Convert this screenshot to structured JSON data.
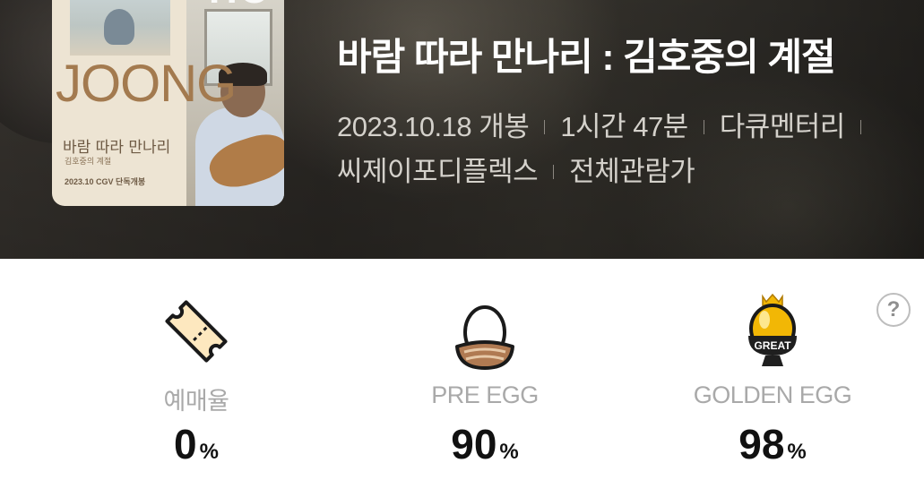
{
  "movie": {
    "title": "바람 따라 만나리 : 김호중의 계절",
    "release": "2023.10.18 개봉",
    "runtime": "1시간 47분",
    "genre": "다큐멘터리",
    "distributor": "씨제이포디플렉스",
    "rating": "전체관람가"
  },
  "poster": {
    "title_text": "JOONG",
    "top_text": "HO",
    "handwriting": "바람 따라 만나리",
    "subtitle": "김호중의 계절",
    "date_line": "2023.10 CGV 단독개봉"
  },
  "stats": [
    {
      "label": "예매율",
      "value": "0",
      "unit": "%",
      "icon": "ticket-icon"
    },
    {
      "label": "PRE EGG",
      "value": "90",
      "unit": "%",
      "icon": "egg-in-nest-icon"
    },
    {
      "label": "GOLDEN EGG",
      "value": "98",
      "unit": "%",
      "icon": "golden-egg-great-icon",
      "badge": "GREAT"
    }
  ],
  "help": {
    "symbol": "?"
  },
  "colors": {
    "hero_bg": "#2e2b27",
    "title": "#ffffff",
    "meta": "#d4d1cb",
    "stat_label": "#a9a9a9",
    "stat_value": "#111111",
    "ticket": "#fde8bf",
    "golden_egg": "#f2b705"
  }
}
